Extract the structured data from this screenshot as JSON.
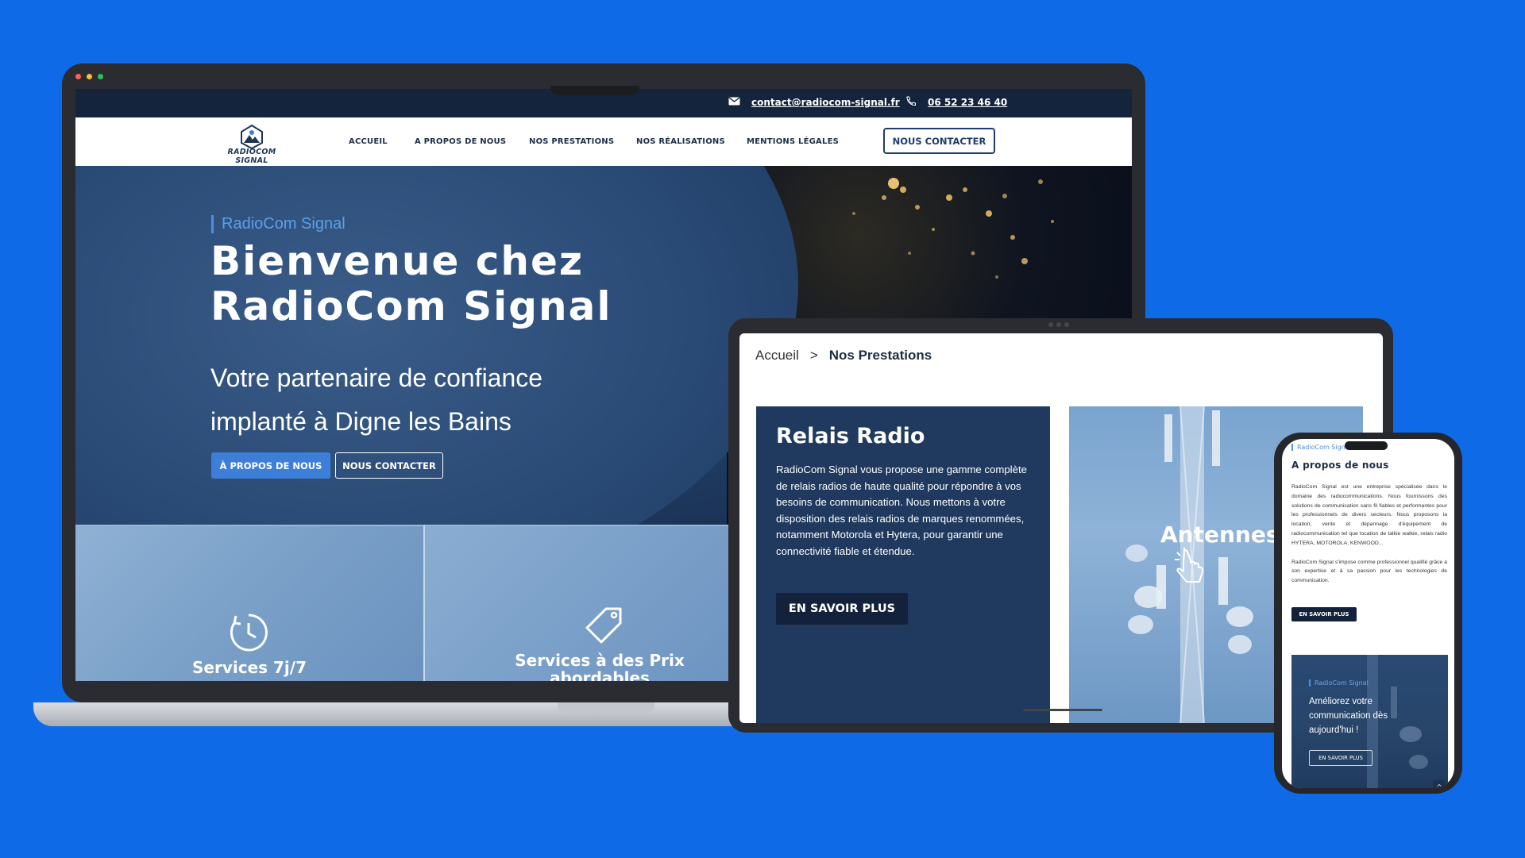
{
  "laptop": {
    "topbar": {
      "email": "contact@radiocom-signal.fr",
      "phone": "06 52 23 46 40"
    },
    "nav": {
      "logo_text": "RADIOCOM SIGNAL",
      "items": [
        "ACCUEIL",
        "A PROPOS DE NOUS",
        "NOS PRESTATIONS",
        "NOS RÉALISATIONS",
        "MENTIONS LÉGALES"
      ],
      "cta": "NOUS CONTACTER"
    },
    "hero": {
      "kicker": "RadioCom Signal",
      "title_line1": "Bienvenue chez",
      "title_line2": "RadioCom Signal",
      "subtitle_line1": "Votre partenaire de confiance",
      "subtitle_line2": "implanté à Digne les Bains",
      "button_about": "À PROPOS DE NOUS",
      "button_contact": "NOUS CONTACTER"
    },
    "cards": [
      {
        "label": "Services 7j/7",
        "icon": "clock-icon"
      },
      {
        "label_line1": "Services à des Prix",
        "label_line2": "abordables",
        "icon": "price-tag-icon"
      }
    ],
    "window_dots": [
      "#ff5f57",
      "#febc2e",
      "#28c840"
    ]
  },
  "tablet": {
    "breadcrumb": {
      "home": "Accueil",
      "separator": ">",
      "current": "Nos Prestations"
    },
    "service": {
      "title": "Relais Radio",
      "text": "RadioCom Signal vous propose une gamme complète de relais radios de haute qualité pour répondre à vos besoins de communication. Nous mettons à votre disposition des relais radios de marques renommées, notamment Motorola et Hytera, pour garantir une connectivité fiable et étendue.",
      "button": "EN SAVOIR PLUS"
    },
    "antenna_card": {
      "title": "Antennes",
      "icon": "hand-pointer-icon"
    }
  },
  "phone": {
    "kicker": "RadioCom Signal",
    "title": "A propos de nous",
    "text1": "RadioCom Signal est une entreprise spécialisée dans le domaine des radiocommunications. Nous fournissons des solutions de communication sans fil fiables et performantes pour les professionnels de divers secteurs. Nous proposons la location, vente et dépannage d'équipement de radiocommunication tel que location de talkie walkie, relais radio HYTERA, MOTOROLA, KENWOOD...",
    "text2": "RadioCom Signal s'impose comme professionnel qualifié grâce à son expertise et à sa passion pour les technologies de communication.",
    "button": "EN SAVOIR PLUS",
    "card": {
      "kicker": "RadioCom Signal",
      "text": "Améliorez votre communication dès aujourd'hui !",
      "button": "EN SAVOIR PLUS"
    },
    "back_to_top": "^"
  },
  "colors": {
    "background": "#0e6ae6",
    "navy": "#1f3a5e",
    "accent_blue": "#3d7fd8"
  }
}
